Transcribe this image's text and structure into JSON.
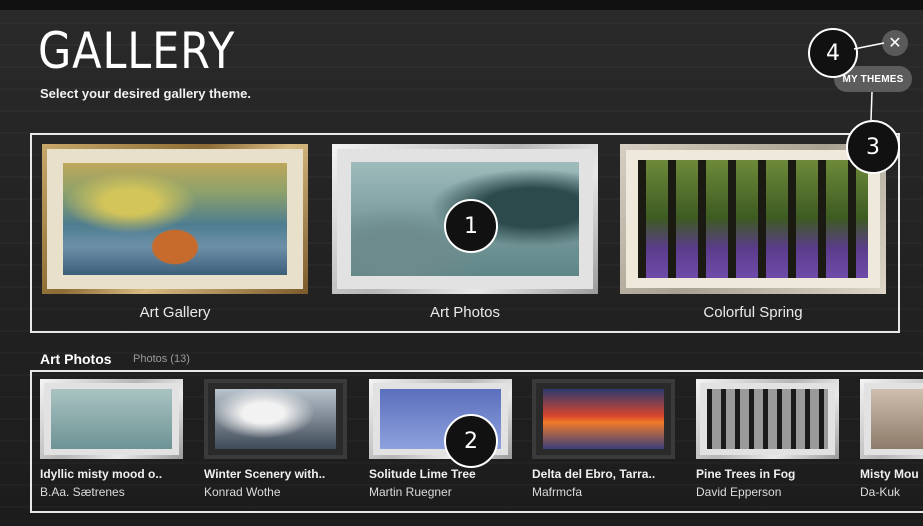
{
  "header": {
    "title": "GALLERY",
    "subtitle": "Select your desired gallery theme."
  },
  "controls": {
    "close_icon": "✕",
    "my_themes_label": "MY THEMES"
  },
  "callouts": [
    "1",
    "2",
    "3",
    "4"
  ],
  "themes": [
    {
      "label": "Art Gallery",
      "frame": "gold",
      "art": "boating-painting"
    },
    {
      "label": "Art Photos",
      "frame": "silver",
      "art": "misty-forest"
    },
    {
      "label": "Colorful Spring",
      "frame": "beige",
      "art": "bluebell-forest"
    }
  ],
  "section": {
    "title": "Art Photos",
    "count": "Photos (13)"
  },
  "photos": [
    {
      "title": "Idyllic misty mood o..",
      "author": "B.Aa. Sætrenes"
    },
    {
      "title": "Winter Scenery with..",
      "author": "Konrad Wothe"
    },
    {
      "title": "Solitude Lime Tree",
      "author": "Martin Ruegner"
    },
    {
      "title": "Delta del Ebro, Tarra..",
      "author": "Mafrmcfa"
    },
    {
      "title": "Pine Trees in Fog",
      "author": "David Epperson"
    },
    {
      "title": "Misty Mou",
      "author": "Da-Kuk"
    }
  ],
  "colors": {
    "background": "#1b1b1b",
    "highlight_border": "#e8e8e8",
    "button_bg": "#5c5c5c",
    "callout_bg": "#111111"
  }
}
